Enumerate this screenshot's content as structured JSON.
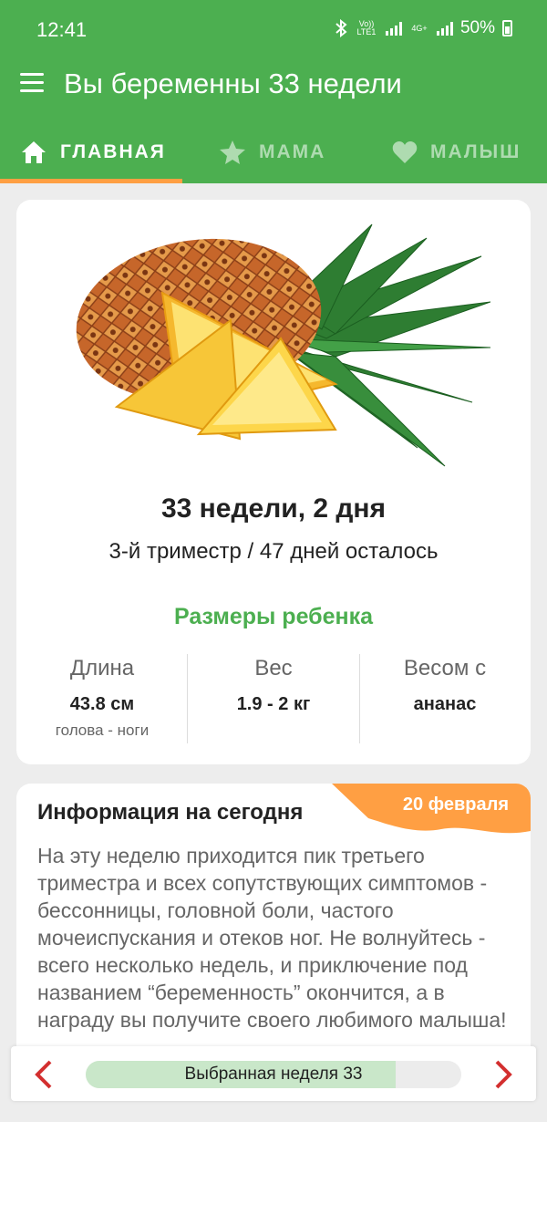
{
  "status_bar": {
    "time": "12:41",
    "volte": "Vo)) LTE1",
    "network": "4G+",
    "battery": "50%"
  },
  "header": {
    "title": "Вы беременны 33 недели"
  },
  "tabs": [
    {
      "label": "ГЛАВНАЯ",
      "icon": "home-icon",
      "active": true
    },
    {
      "label": "МАМА",
      "icon": "star-icon",
      "active": false
    },
    {
      "label": "МАЛЫШ",
      "icon": "heart-icon",
      "active": false
    }
  ],
  "summary": {
    "fruit_image": "pineapple",
    "weeks_text": "33 недели, 2 дня",
    "trimester_text": "3-й триместр / 47 дней осталось",
    "sizes_title": "Размеры ребенка",
    "stats": [
      {
        "label": "Длина",
        "value": "43.8 см",
        "sub": "голова - ноги"
      },
      {
        "label": "Вес",
        "value": "1.9 - 2 кг",
        "sub": ""
      },
      {
        "label": "Весом с",
        "value": "ананас",
        "sub": ""
      }
    ]
  },
  "info": {
    "title": "Информация на сегодня",
    "date": "20 февраля",
    "body": "На эту неделю приходится пик третьего триместра и всех сопутствующих симптомов - бессонницы, головной боли, частого мочеиспускания и отеков ног. Не волнуйтесь - всего несколько недель, и приключение под названием “беременность” окончится, а в награду вы получите своего любимого малыша!"
  },
  "week_selector": {
    "label": "Выбранная неделя 33",
    "progress": 0.825
  },
  "colors": {
    "primary": "#4caf50",
    "accent": "#ff9f43",
    "nav_arrow": "#d32f2f"
  }
}
